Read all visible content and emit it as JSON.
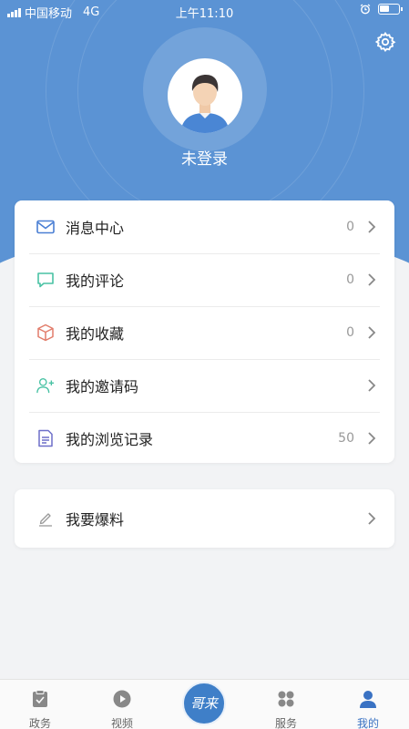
{
  "status_bar": {
    "carrier": "中国移动",
    "network": "4G",
    "time": "上午11:10"
  },
  "profile": {
    "name": "未登录"
  },
  "menu": [
    {
      "label": "消息中心",
      "count": "0",
      "icon": "mail-icon",
      "color": "#4a7fd4"
    },
    {
      "label": "我的评论",
      "count": "0",
      "icon": "comment-icon",
      "color": "#49c2a4"
    },
    {
      "label": "我的收藏",
      "count": "0",
      "icon": "box-icon",
      "color": "#e27c6b"
    },
    {
      "label": "我的邀请码",
      "count": "",
      "icon": "add-user-icon",
      "color": "#49c2a4"
    },
    {
      "label": "我的浏览记录",
      "count": "50",
      "icon": "document-icon",
      "color": "#6d6fc9"
    }
  ],
  "report": {
    "label": "我要爆料",
    "icon": "pencil-icon"
  },
  "tabbar": {
    "tabs": [
      {
        "label": "政务",
        "icon": "clipboard-icon"
      },
      {
        "label": "视频",
        "icon": "play-icon"
      },
      {
        "label": "服务",
        "icon": "grid-icon"
      },
      {
        "label": "我的",
        "icon": "person-icon",
        "active": true
      }
    ],
    "center_logo": "哥来"
  },
  "colors": {
    "header": "#5b93d4",
    "accent": "#3a72c3",
    "background": "#f2f3f5"
  }
}
